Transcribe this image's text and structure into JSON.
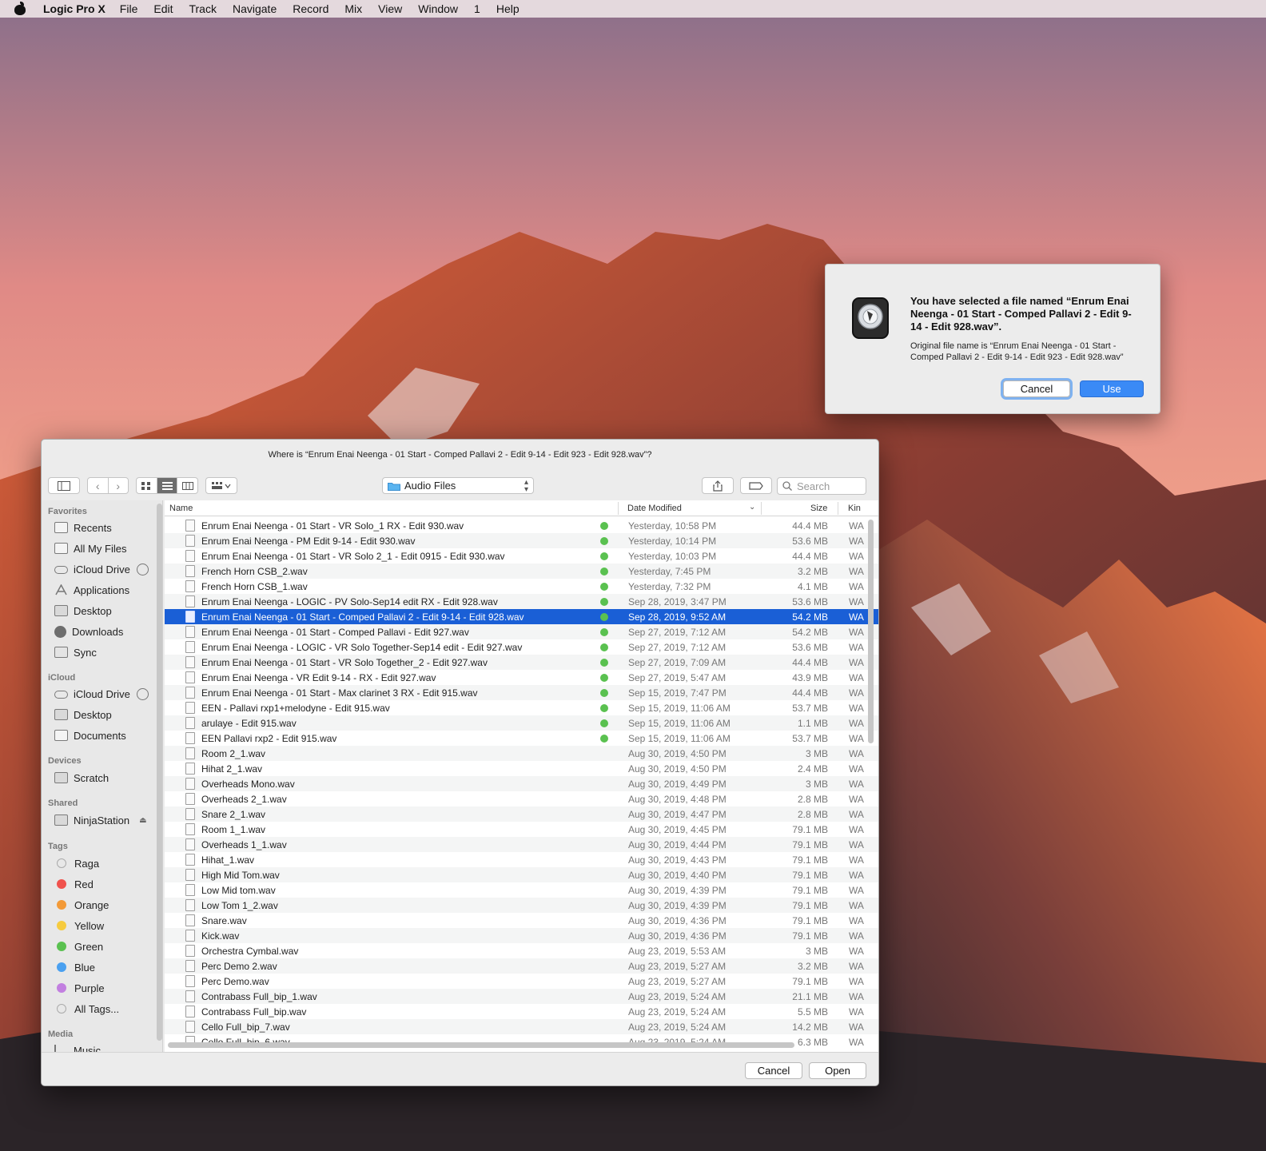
{
  "menubar": {
    "app_name": "Logic Pro X",
    "items": [
      "File",
      "Edit",
      "Track",
      "Navigate",
      "Record",
      "Mix",
      "View",
      "Window",
      "1",
      "Help"
    ]
  },
  "alert": {
    "title": "You have selected a file named “Enrum Enai Neenga - 01 Start - Comped Pallavi 2 - Edit 9-14 - Edit 928.wav”.",
    "body": "Original file name is “Enrum Enai Neenga - 01 Start - Comped Pallavi 2 - Edit 9-14 - Edit 923 - Edit 928.wav”",
    "cancel_label": "Cancel",
    "use_label": "Use",
    "icon": "logic-pro-icon"
  },
  "panel": {
    "title": "Where is “Enrum Enai Neenga - 01 Start - Comped Pallavi 2 - Edit 9-14 - Edit 923 - Edit 928.wav”?",
    "location": "Audio Files",
    "search_placeholder": "Search",
    "cancel_label": "Cancel",
    "open_label": "Open"
  },
  "sidebar": {
    "favorites_label": "Favorites",
    "favorites": [
      {
        "label": "Recents",
        "icon": "recents-icon"
      },
      {
        "label": "All My Files",
        "icon": "all-files-icon"
      },
      {
        "label": "iCloud Drive",
        "icon": "cloud-icon"
      },
      {
        "label": "Applications",
        "icon": "applications-icon"
      },
      {
        "label": "Desktop",
        "icon": "desktop-icon"
      },
      {
        "label": "Downloads",
        "icon": "downloads-icon"
      },
      {
        "label": "Sync",
        "icon": "folder-icon"
      }
    ],
    "icloud_label": "iCloud",
    "icloud": [
      {
        "label": "iCloud Drive",
        "icon": "cloud-icon"
      },
      {
        "label": "Desktop",
        "icon": "desktop-icon"
      },
      {
        "label": "Documents",
        "icon": "documents-icon"
      }
    ],
    "devices_label": "Devices",
    "devices": [
      {
        "label": "Scratch",
        "icon": "disk-icon"
      }
    ],
    "shared_label": "Shared",
    "shared": [
      {
        "label": "NinjaStation",
        "icon": "server-icon"
      }
    ],
    "tags_label": "Tags",
    "tags": [
      {
        "label": "Raga",
        "color": "#e8e8e8"
      },
      {
        "label": "Red",
        "color": "#f0524d"
      },
      {
        "label": "Orange",
        "color": "#f39a38"
      },
      {
        "label": "Yellow",
        "color": "#f6cb3f"
      },
      {
        "label": "Green",
        "color": "#5ac150"
      },
      {
        "label": "Blue",
        "color": "#4aa0f0"
      },
      {
        "label": "Purple",
        "color": "#c27fe0"
      },
      {
        "label": "All Tags...",
        "color": "#e8e8e8"
      }
    ],
    "media_label": "Media",
    "media": [
      {
        "label": "Music",
        "icon": "music-icon"
      }
    ]
  },
  "columns": {
    "name": "Name",
    "date": "Date Modified",
    "size": "Size",
    "kind": "Kin"
  },
  "tag_color_green": "#5ac150",
  "files": [
    {
      "name": "Enrum Enai Neenga - 01 Start - VR Solo_1 RX - Edit 930.wav",
      "date": "Yesterday, 10:58 PM",
      "size": "44.4 MB",
      "kind": "WA",
      "tag": true
    },
    {
      "name": "Enrum Enai Neenga - PM Edit 9-14 - Edit 930.wav",
      "date": "Yesterday, 10:14 PM",
      "size": "53.6 MB",
      "kind": "WA",
      "tag": true
    },
    {
      "name": "Enrum Enai Neenga - 01 Start - VR Solo 2_1 - Edit 0915 - Edit 930.wav",
      "date": "Yesterday, 10:03 PM",
      "size": "44.4 MB",
      "kind": "WA",
      "tag": true
    },
    {
      "name": "French Horn CSB_2.wav",
      "date": "Yesterday, 7:45 PM",
      "size": "3.2 MB",
      "kind": "WA",
      "tag": true
    },
    {
      "name": "French Horn CSB_1.wav",
      "date": "Yesterday, 7:32 PM",
      "size": "4.1 MB",
      "kind": "WA",
      "tag": true
    },
    {
      "name": "Enrum Enai Neenga - LOGIC - PV Solo-Sep14 edit RX - Edit 928.wav",
      "date": "Sep 28, 2019, 3:47 PM",
      "size": "53.6 MB",
      "kind": "WA",
      "tag": true
    },
    {
      "name": "Enrum Enai Neenga - 01 Start - Comped Pallavi 2 - Edit 9-14 - Edit 928.wav",
      "date": "Sep 28, 2019, 9:52 AM",
      "size": "54.2 MB",
      "kind": "WA",
      "tag": true,
      "selected": true
    },
    {
      "name": "Enrum Enai Neenga - 01 Start - Comped Pallavi - Edit 927.wav",
      "date": "Sep 27, 2019, 7:12 AM",
      "size": "54.2 MB",
      "kind": "WA",
      "tag": true
    },
    {
      "name": "Enrum Enai Neenga - LOGIC - VR Solo Together-Sep14 edit - Edit 927.wav",
      "date": "Sep 27, 2019, 7:12 AM",
      "size": "53.6 MB",
      "kind": "WA",
      "tag": true
    },
    {
      "name": "Enrum Enai Neenga - 01 Start - VR Solo Together_2 - Edit 927.wav",
      "date": "Sep 27, 2019, 7:09 AM",
      "size": "44.4 MB",
      "kind": "WA",
      "tag": true
    },
    {
      "name": "Enrum Enai Neenga - VR Edit 9-14 - RX - Edit 927.wav",
      "date": "Sep 27, 2019, 5:47 AM",
      "size": "43.9 MB",
      "kind": "WA",
      "tag": true
    },
    {
      "name": "Enrum Enai Neenga - 01 Start - Max clarinet 3 RX - Edit 915.wav",
      "date": "Sep 15, 2019, 7:47 PM",
      "size": "44.4 MB",
      "kind": "WA",
      "tag": true
    },
    {
      "name": "EEN - Pallavi rxp1+melodyne - Edit 915.wav",
      "date": "Sep 15, 2019, 11:06 AM",
      "size": "53.7 MB",
      "kind": "WA",
      "tag": true
    },
    {
      "name": "arulaye - Edit 915.wav",
      "date": "Sep 15, 2019, 11:06 AM",
      "size": "1.1 MB",
      "kind": "WA",
      "tag": true
    },
    {
      "name": "EEN Pallavi rxp2 - Edit 915.wav",
      "date": "Sep 15, 2019, 11:06 AM",
      "size": "53.7 MB",
      "kind": "WA",
      "tag": true
    },
    {
      "name": "Room 2_1.wav",
      "date": "Aug 30, 2019, 4:50 PM",
      "size": "3 MB",
      "kind": "WA",
      "tag": false
    },
    {
      "name": "Hihat 2_1.wav",
      "date": "Aug 30, 2019, 4:50 PM",
      "size": "2.4 MB",
      "kind": "WA",
      "tag": false
    },
    {
      "name": "Overheads Mono.wav",
      "date": "Aug 30, 2019, 4:49 PM",
      "size": "3 MB",
      "kind": "WA",
      "tag": false
    },
    {
      "name": "Overheads 2_1.wav",
      "date": "Aug 30, 2019, 4:48 PM",
      "size": "2.8 MB",
      "kind": "WA",
      "tag": false
    },
    {
      "name": "Snare 2_1.wav",
      "date": "Aug 30, 2019, 4:47 PM",
      "size": "2.8 MB",
      "kind": "WA",
      "tag": false
    },
    {
      "name": "Room 1_1.wav",
      "date": "Aug 30, 2019, 4:45 PM",
      "size": "79.1 MB",
      "kind": "WA",
      "tag": false
    },
    {
      "name": "Overheads 1_1.wav",
      "date": "Aug 30, 2019, 4:44 PM",
      "size": "79.1 MB",
      "kind": "WA",
      "tag": false
    },
    {
      "name": "Hihat_1.wav",
      "date": "Aug 30, 2019, 4:43 PM",
      "size": "79.1 MB",
      "kind": "WA",
      "tag": false
    },
    {
      "name": "High Mid Tom.wav",
      "date": "Aug 30, 2019, 4:40 PM",
      "size": "79.1 MB",
      "kind": "WA",
      "tag": false
    },
    {
      "name": "Low Mid tom.wav",
      "date": "Aug 30, 2019, 4:39 PM",
      "size": "79.1 MB",
      "kind": "WA",
      "tag": false
    },
    {
      "name": "Low Tom 1_2.wav",
      "date": "Aug 30, 2019, 4:39 PM",
      "size": "79.1 MB",
      "kind": "WA",
      "tag": false
    },
    {
      "name": "Snare.wav",
      "date": "Aug 30, 2019, 4:36 PM",
      "size": "79.1 MB",
      "kind": "WA",
      "tag": false
    },
    {
      "name": "Kick.wav",
      "date": "Aug 30, 2019, 4:36 PM",
      "size": "79.1 MB",
      "kind": "WA",
      "tag": false
    },
    {
      "name": "Orchestra Cymbal.wav",
      "date": "Aug 23, 2019, 5:53 AM",
      "size": "3 MB",
      "kind": "WA",
      "tag": false
    },
    {
      "name": "Perc Demo 2.wav",
      "date": "Aug 23, 2019, 5:27 AM",
      "size": "3.2 MB",
      "kind": "WA",
      "tag": false
    },
    {
      "name": "Perc Demo.wav",
      "date": "Aug 23, 2019, 5:27 AM",
      "size": "79.1 MB",
      "kind": "WA",
      "tag": false
    },
    {
      "name": "Contrabass Full_bip_1.wav",
      "date": "Aug 23, 2019, 5:24 AM",
      "size": "21.1 MB",
      "kind": "WA",
      "tag": false
    },
    {
      "name": "Contrabass Full_bip.wav",
      "date": "Aug 23, 2019, 5:24 AM",
      "size": "5.5 MB",
      "kind": "WA",
      "tag": false
    },
    {
      "name": "Cello Full_bip_7.wav",
      "date": "Aug 23, 2019, 5:24 AM",
      "size": "14.2 MB",
      "kind": "WA",
      "tag": false
    },
    {
      "name": "Cello Full_bip_6.wav",
      "date": "Aug 23, 2019, 5:24 AM",
      "size": "6.3 MB",
      "kind": "WA",
      "tag": false
    }
  ]
}
